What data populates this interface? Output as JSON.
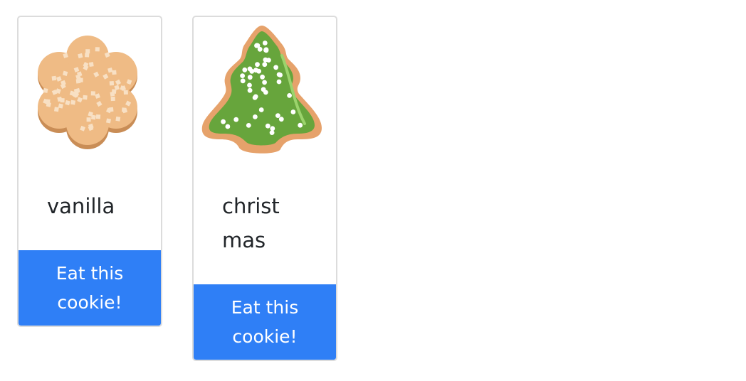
{
  "cookies": [
    {
      "name": "vanilla",
      "button_label": "Eat this cookie!",
      "image_icon": "vanilla-flower-cookie-icon",
      "colors": {
        "dough": "#efbb85",
        "edge": "#c98d56",
        "sprinkles": "#f8e0c4"
      }
    },
    {
      "name": "christmas",
      "button_label": "Eat this cookie!",
      "image_icon": "christmas-tree-cookie-icon",
      "colors": {
        "dough": "#e6a26b",
        "icing": "#67a53c",
        "highlight": "#9bd36c",
        "sprinkles": "#ffffff"
      }
    }
  ],
  "colors": {
    "button": "#2f7ff6",
    "border": "#dcdcdc"
  }
}
